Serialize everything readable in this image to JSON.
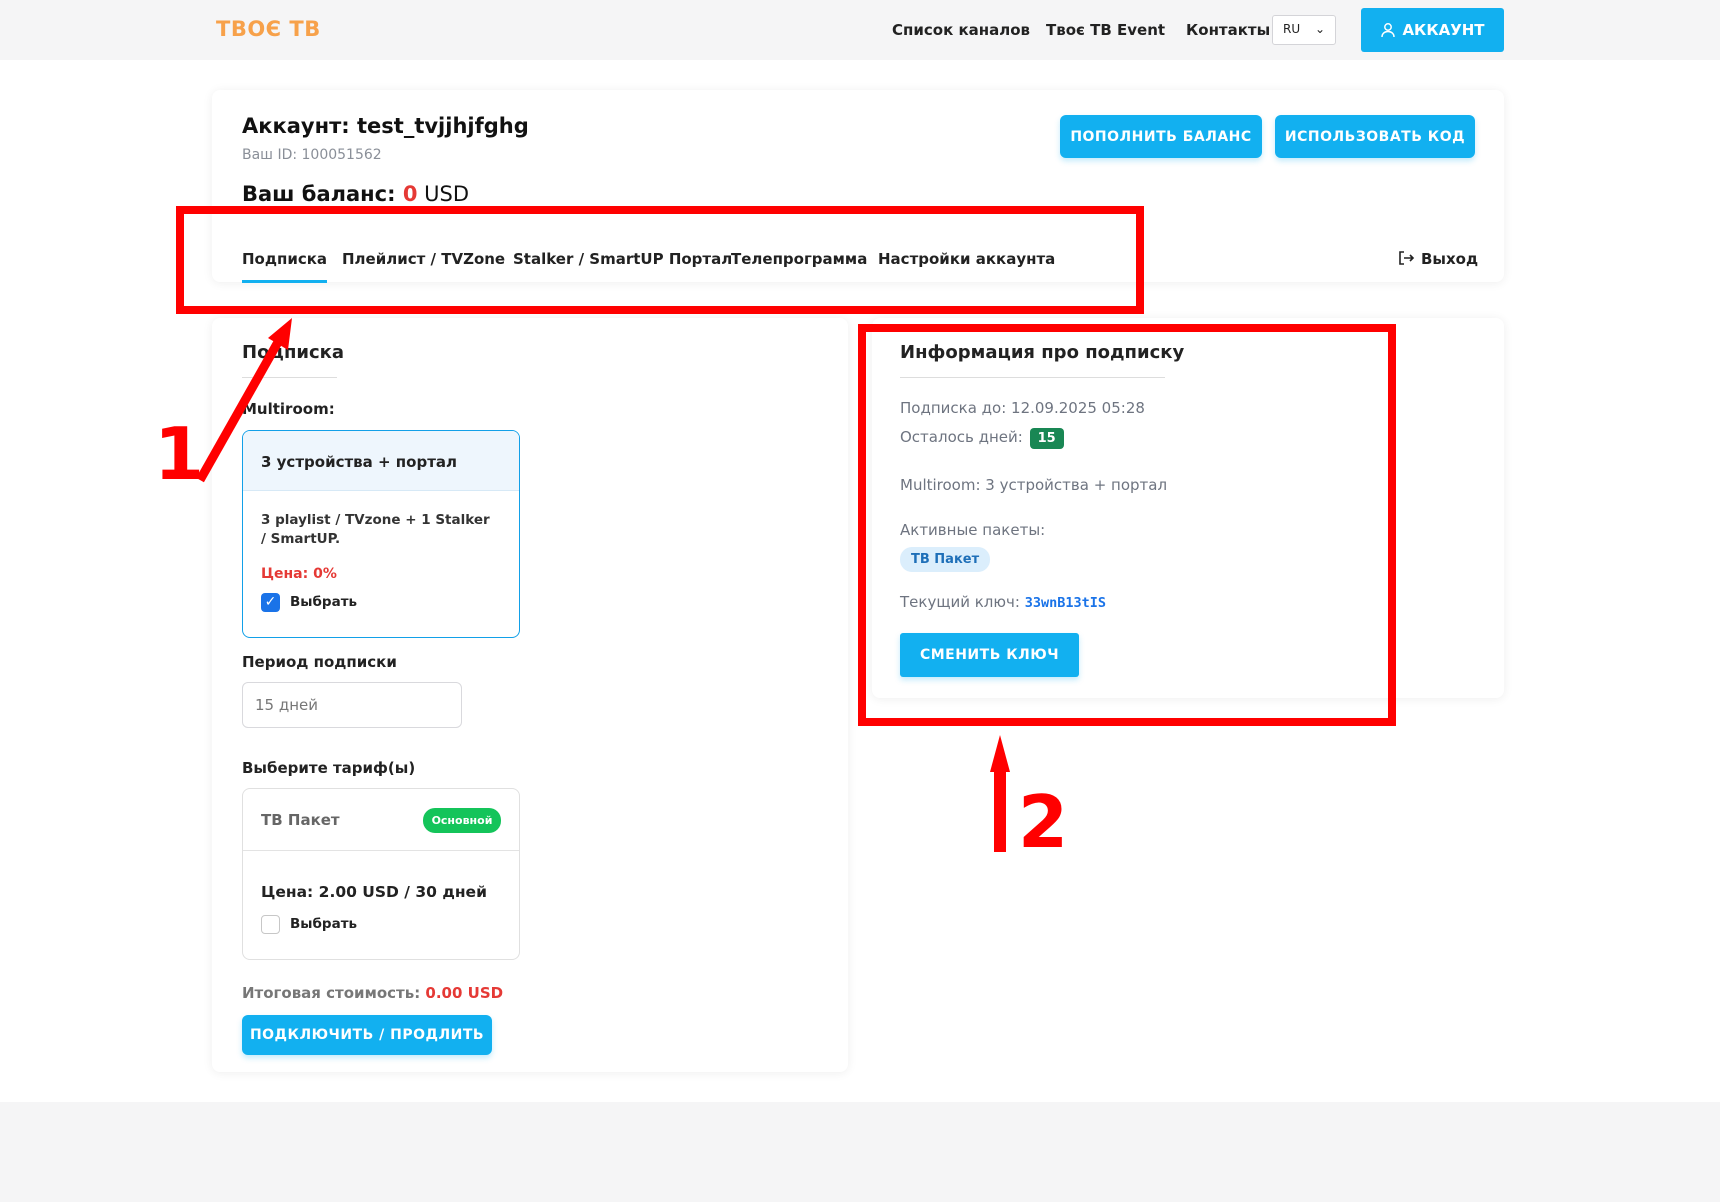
{
  "header": {
    "logo": "ТВОЄ ТВ",
    "nav": [
      "Список каналов",
      "Твоє ТВ Event",
      "Контакты"
    ],
    "lang": "RU",
    "account_button": "АККАУНТ"
  },
  "account": {
    "title": "Аккаунт: test_tvjjhjfghg",
    "id_text": "Ваш ID: 100051562",
    "balance_label": "Ваш баланс: ",
    "balance_value": "0",
    "balance_currency": " USD",
    "topup_button": "ПОПОЛНИТЬ БАЛАНС",
    "use_code_button": "ИСПОЛЬЗОВАТЬ КОД"
  },
  "tabs": [
    "Подписка",
    "Плейлист / TVZone",
    "Stalker / SmartUP Портал",
    "Телепрограмма",
    "Настройки аккаунта"
  ],
  "logout": "Выход",
  "subscription": {
    "title": "Подписка",
    "multiroom_label": "Multiroom:",
    "plan": {
      "name": "3 устройства + портал",
      "desc": "3 playlist / TVzone + 1 Stalker / SmartUP.",
      "price": "Цена: 0%",
      "select_label": "Выбрать",
      "selected": true
    },
    "period_label": "Период подписки",
    "period_value": "15 дней",
    "tariffs_label": "Выберите тариф(ы)",
    "tariff": {
      "name": "ТВ Пакет",
      "badge": "Основной",
      "price": "Цена: 2.00 USD / 30 дней",
      "select_label": "Выбрать",
      "selected": false
    },
    "total_label": "Итоговая стоимость: ",
    "total_value": "0.00 USD",
    "connect_button": "ПОДКЛЮЧИТЬ / ПРОДЛИТЬ"
  },
  "info": {
    "title": "Информация про подписку",
    "until": "Подписка до: 12.09.2025 05:28",
    "days_left_label": "Осталось дней:",
    "days_left": "15",
    "multiroom": "Multiroom: 3 устройства + портал",
    "active_packages_label": "Активные пакеты:",
    "package": "ТВ Пакет",
    "key_label": "Текущий ключ: ",
    "key_value": "33wnB13tIS",
    "change_key_button": "СМЕНИТЬ КЛЮЧ"
  },
  "annotations": [
    "1",
    "2"
  ],
  "colors": {
    "accent": "#12b0f0",
    "logo": "#f7a14a",
    "highlight": "#ff0000",
    "price_red": "#e53935",
    "badge_green": "#14c45a"
  }
}
